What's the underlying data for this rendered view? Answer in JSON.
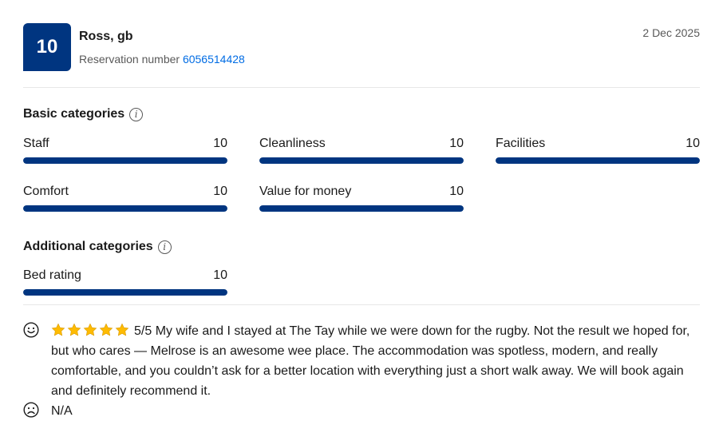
{
  "review": {
    "score": "10",
    "reviewer": "Ross, gb",
    "reservation_label": "Reservation number",
    "reservation_number": "6056514428",
    "date": "2 Dec 2025"
  },
  "basic": {
    "title": "Basic categories",
    "items": [
      {
        "label": "Staff",
        "score": "10",
        "fraction": 1.0
      },
      {
        "label": "Cleanliness",
        "score": "10",
        "fraction": 1.0
      },
      {
        "label": "Facilities",
        "score": "10",
        "fraction": 1.0
      },
      {
        "label": "Comfort",
        "score": "10",
        "fraction": 1.0
      },
      {
        "label": "Value for money",
        "score": "10",
        "fraction": 1.0
      }
    ]
  },
  "additional": {
    "title": "Additional categories",
    "items": [
      {
        "label": "Bed rating",
        "score": "10",
        "fraction": 1.0
      }
    ]
  },
  "comments": {
    "stars": 5,
    "positive": "5/5 My wife and I stayed at The Tay while we were down for the rugby. Not the result we hoped for, but who cares — Melrose is an awesome wee place. The accommodation was spotless, modern, and really comfortable, and you couldn’t ask for a better location with everything just a short walk away. We will book again and definitely recommend it.",
    "negative": "N/A"
  },
  "colors": {
    "brand": "#003580",
    "link": "#006ce4",
    "star": "#febb02"
  },
  "icons": {
    "info": "info-icon",
    "positive": "happy-face-icon",
    "negative": "sad-face-icon",
    "star": "star-icon"
  }
}
